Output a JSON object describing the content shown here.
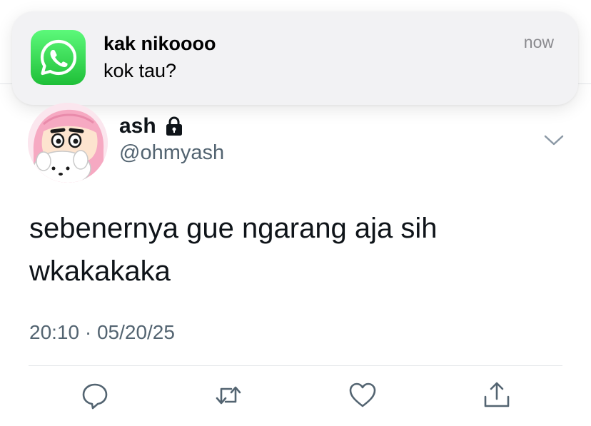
{
  "notification": {
    "app_icon": "whatsapp-icon",
    "sender": "kak nikoooo",
    "message": "kok tau?",
    "time": "now"
  },
  "tweet": {
    "author_name": "ash",
    "author_handle": "@ohmyash",
    "protected_icon": "lock-icon",
    "text": "sebenernya gue ngarang aja sih wkakakaka",
    "timestamp": "20:10 · 05/20/25"
  },
  "actions": [
    {
      "icon": "reply-icon"
    },
    {
      "icon": "retweet-icon"
    },
    {
      "icon": "like-icon"
    },
    {
      "icon": "share-icon"
    }
  ],
  "colors": {
    "text_primary": "#0f1419",
    "text_secondary": "#536471",
    "whatsapp_green": "#25d366"
  }
}
